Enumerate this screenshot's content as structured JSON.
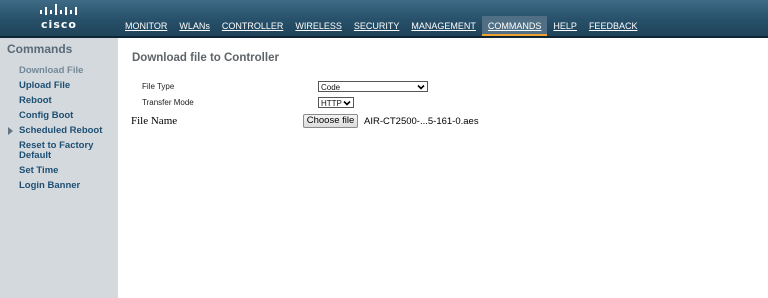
{
  "header": {
    "logo_text": "cisco",
    "nav": [
      {
        "label": "MONITOR",
        "active": false
      },
      {
        "label": "WLANs",
        "active": false
      },
      {
        "label": "CONTROLLER",
        "active": false
      },
      {
        "label": "WIRELESS",
        "active": false
      },
      {
        "label": "SECURITY",
        "active": false
      },
      {
        "label": "MANAGEMENT",
        "active": false
      },
      {
        "label": "COMMANDS",
        "active": true
      },
      {
        "label": "HELP",
        "active": false
      },
      {
        "label": "FEEDBACK",
        "active": false
      }
    ]
  },
  "sidebar": {
    "title": "Commands",
    "items": [
      {
        "label": "Download File",
        "active": true
      },
      {
        "label": "Upload File"
      },
      {
        "label": "Reboot"
      },
      {
        "label": "Config Boot"
      },
      {
        "label": "Scheduled Reboot",
        "expandable": true
      },
      {
        "label": "Reset to Factory Default"
      },
      {
        "label": "Set Time"
      },
      {
        "label": "Login Banner"
      }
    ]
  },
  "main": {
    "title": "Download file to Controller",
    "form": {
      "file_type_label": "File Type",
      "file_type_value": "Code",
      "transfer_mode_label": "Transfer Mode",
      "transfer_mode_value": "HTTP",
      "file_name_label": "File Name",
      "choose_button": "Choose file",
      "chosen_file": "AIR-CT2500-...5-161-0.aes"
    }
  },
  "colors": {
    "header": "#27506a",
    "active_tab_underline": "#f0a22e",
    "sidebar_bg": "#d4d9dd",
    "link": "#1d4f73"
  }
}
